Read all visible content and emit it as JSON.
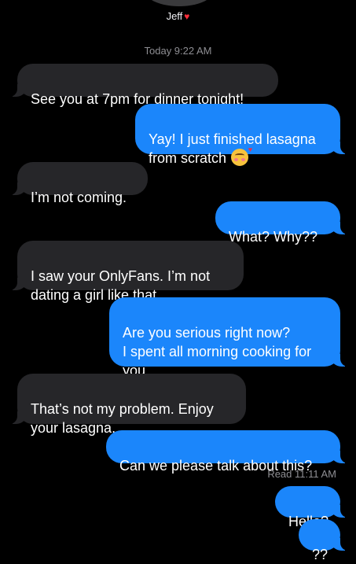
{
  "header": {
    "contact_name": "Jeff",
    "contact_emoji": "♥"
  },
  "conversation": {
    "timestamp": "Today 9:22 AM",
    "messages": [
      {
        "direction": "incoming",
        "text": "See you at 7pm for dinner tonight!"
      },
      {
        "direction": "outgoing",
        "text": "Yay! I just finished lasagna\nfrom scratch",
        "emoji": "smiling-face-with-hearts"
      },
      {
        "direction": "incoming",
        "text": "I’m not coming."
      },
      {
        "direction": "outgoing",
        "text": "What? Why??"
      },
      {
        "direction": "incoming",
        "text": "I saw your OnlyFans. I’m not\ndating a girl like that."
      },
      {
        "direction": "outgoing",
        "text": "Are you serious right now?\nI spent all morning cooking for\nyou..."
      },
      {
        "direction": "incoming",
        "text": "That’s not my problem. Enjoy\nyour lasagna."
      },
      {
        "direction": "outgoing",
        "text": "Can we please talk about this?"
      },
      {
        "direction": "outgoing",
        "text": "Hello?"
      },
      {
        "direction": "outgoing",
        "text": "??"
      }
    ],
    "read_receipt": "Read 11:11 AM"
  },
  "colors": {
    "background": "#000000",
    "incoming_bubble": "#262629",
    "outgoing_bubble": "#1b86fb",
    "meta_text": "#8e8e93"
  }
}
